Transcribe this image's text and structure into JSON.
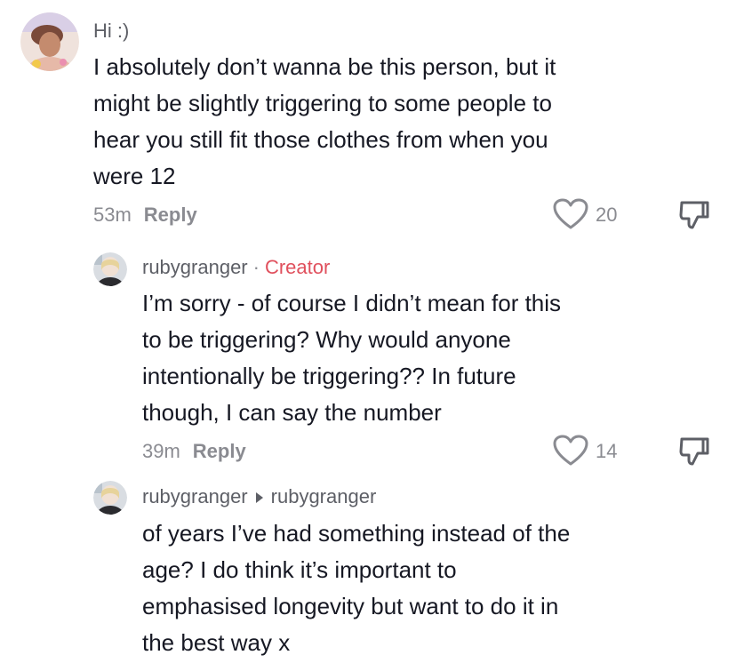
{
  "comments": [
    {
      "username": "Hi :)",
      "text_lines": [
        "I absolutely don’t wanna be this person, but it",
        "might be slightly triggering to some people to",
        "hear you still fit those clothes from when you",
        "were 12"
      ],
      "time": "53m",
      "reply_label": "Reply",
      "likes": "20"
    },
    {
      "username": "rubygranger",
      "separator": "·",
      "badge": "Creator",
      "text_lines": [
        "I’m sorry - of course I didn’t mean for this",
        "to be triggering? Why would anyone",
        "intentionally be triggering?? In future",
        "though, I can say the number"
      ],
      "time": "39m",
      "reply_label": "Reply",
      "likes": "14"
    },
    {
      "username": "rubygranger",
      "reply_to": "rubygranger",
      "text_lines": [
        "of years I’ve had something instead of the",
        "age? I do think it’s important to",
        "emphasised longevity but want to do it in",
        "the best way x"
      ]
    }
  ],
  "colors": {
    "creator_badge": "#e0505d",
    "muted": "#8a8b91",
    "text": "#161823"
  },
  "icons": [
    "heart-outline-icon",
    "thumbs-down-icon",
    "play-arrow-icon"
  ]
}
